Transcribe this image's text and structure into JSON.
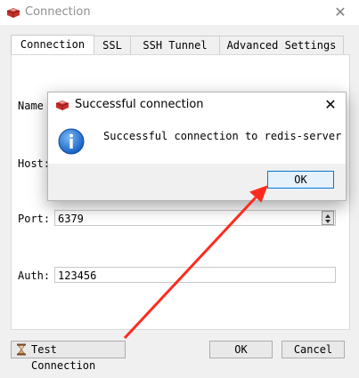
{
  "window": {
    "title": "Connection",
    "close_icon": "close-icon"
  },
  "tabs": [
    {
      "label": "Connection",
      "active": true
    },
    {
      "label": "SSL",
      "active": false
    },
    {
      "label": "SSH Tunnel",
      "active": false
    },
    {
      "label": "Advanced Settings",
      "active": false
    }
  ],
  "form": {
    "name_label": "Name",
    "host_label": "Host:",
    "port_label": "Port:",
    "port_value": "6379",
    "auth_label": "Auth:",
    "auth_value": "123456"
  },
  "buttons": {
    "test_connection": "Test Connection",
    "ok": "OK",
    "cancel": "Cancel"
  },
  "dialog": {
    "title": "Successful connection",
    "message": "Successful connection to redis-server",
    "ok": "OK",
    "icon": "info-icon"
  },
  "annotation": {
    "arrow_color": "#ff2a1f"
  }
}
